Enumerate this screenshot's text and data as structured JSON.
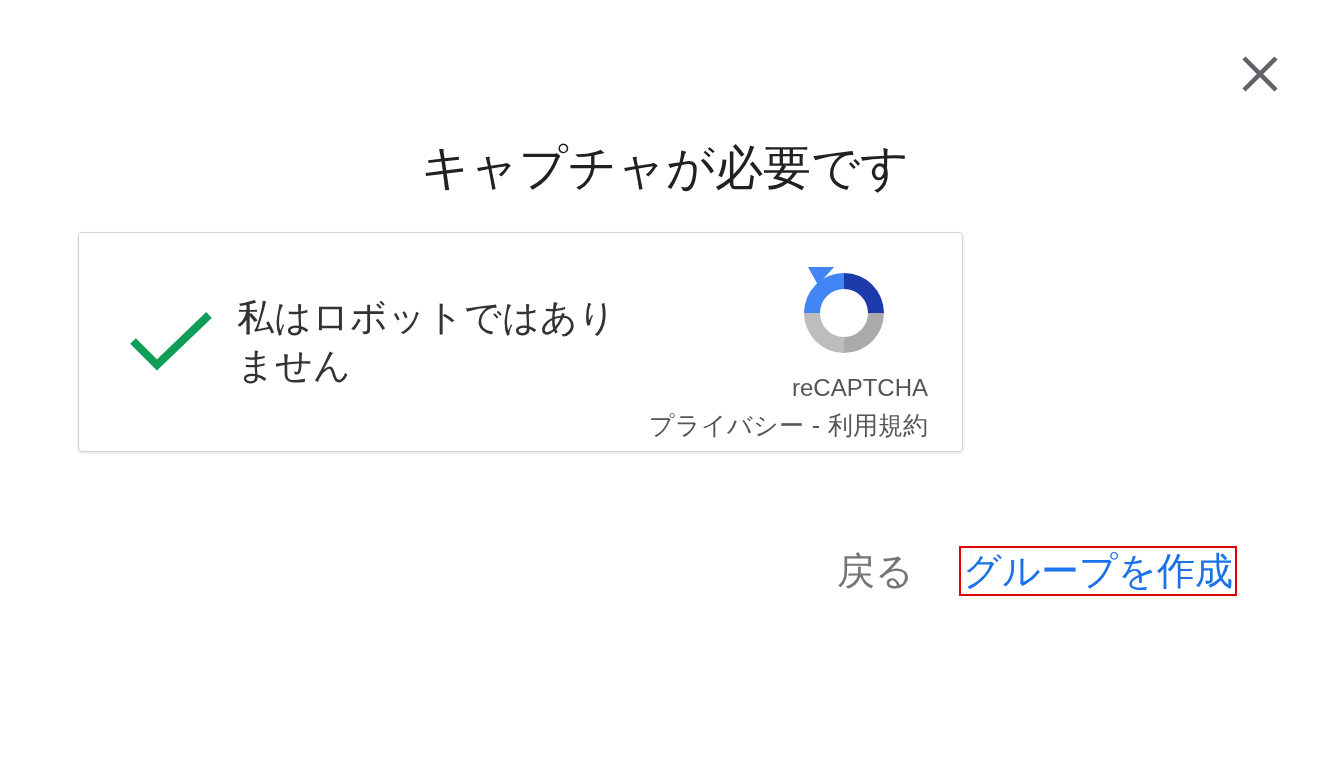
{
  "dialog": {
    "title": "キャプチャが必要です"
  },
  "captcha": {
    "checked": true,
    "label": "私はロボットではありません",
    "brand": "reCAPTCHA",
    "privacy_link": "プライバシー",
    "separator": "-",
    "terms_link": "利用規約"
  },
  "buttons": [
    {
      "label": "戻る",
      "kind": "secondary",
      "highlighted": false
    },
    {
      "label": "グループを作成",
      "kind": "primary",
      "highlighted": true
    }
  ]
}
